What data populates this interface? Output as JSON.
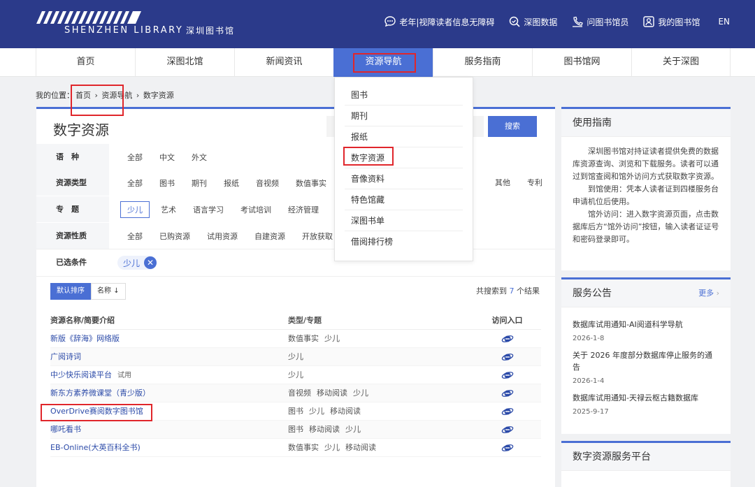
{
  "header": {
    "logo_en": "SHENZHEN LIBRARY",
    "logo_cn": "深圳图书馆",
    "links": [
      {
        "label": "老年|视障读者信息无障碍",
        "icon": "accessibility-chat-icon"
      },
      {
        "label": "深图数据",
        "icon": "search-data-icon"
      },
      {
        "label": "问图书馆员",
        "icon": "librarian-icon"
      },
      {
        "label": "我的图书馆",
        "icon": "user-card-icon"
      },
      {
        "label": "EN",
        "icon": ""
      }
    ]
  },
  "nav": {
    "items": [
      "首页",
      "深图北馆",
      "新闻资讯",
      "资源导航",
      "服务指南",
      "图书馆网",
      "关于深图"
    ],
    "active_index": 3
  },
  "breadcrumb": {
    "prefix": "我的位置：",
    "items": [
      "首页",
      "资源导航",
      "数字资源"
    ],
    "sep": "›"
  },
  "main": {
    "title": "数字资源",
    "search_button": "搜索",
    "filters": [
      {
        "label": "语　种",
        "options": [
          "全部",
          "中文",
          "外文"
        ]
      },
      {
        "label": "资源类型",
        "options": [
          "全部",
          "图书",
          "期刊",
          "报纸",
          "音视频",
          "数值事实"
        ],
        "options_right": [
          "其他",
          "专利"
        ]
      },
      {
        "label": "专　题",
        "options": [
          "少儿",
          "艺术",
          "语言学习",
          "考试培训",
          "经济管理"
        ],
        "selected": "少儿"
      },
      {
        "label": "资源性质",
        "options": [
          "全部",
          "已购资源",
          "试用资源",
          "自建资源",
          "开放获取"
        ]
      }
    ],
    "selected_label": "已选条件",
    "selected_tag": "少儿",
    "sort_default": "默认排序",
    "sort_name": "名称",
    "result_prefix": "共搜索到",
    "result_count": "7",
    "result_suffix": "个结果",
    "table": {
      "headers": [
        "资源名称/简要介绍",
        "类型/专题",
        "访问入口"
      ],
      "rows": [
        {
          "name": "新版《辞海》网络版",
          "trial": "",
          "tags": [
            "数值事实",
            "少儿"
          ]
        },
        {
          "name": "广阅诗词",
          "trial": "",
          "tags": [
            "少儿"
          ]
        },
        {
          "name": "中少快乐阅读平台",
          "trial": "试用",
          "tags": [
            "少儿"
          ]
        },
        {
          "name": "新东方素养微课堂（青少版）",
          "trial": "",
          "tags": [
            "音视频",
            "移动阅读",
            "少儿"
          ]
        },
        {
          "name": "OverDrive赛阅数字图书馆",
          "trial": "",
          "tags": [
            "图书",
            "少儿",
            "移动阅读"
          ]
        },
        {
          "name": "哪吒看书",
          "trial": "",
          "tags": [
            "图书",
            "移动阅读",
            "少儿"
          ]
        },
        {
          "name": "EB-Online(大英百科全书)",
          "trial": "",
          "tags": [
            "数值事实",
            "少儿",
            "移动阅读"
          ]
        }
      ]
    }
  },
  "dropdown": {
    "items": [
      "图书",
      "期刊",
      "报纸",
      "数字资源",
      "音像资料",
      "特色馆藏",
      "深图书单",
      "借阅排行榜"
    ],
    "highlight_index": 3
  },
  "sidebar": {
    "guide": {
      "title": "使用指南",
      "paragraphs": [
        "深圳图书馆对持证读者提供免费的数据库资源查询、浏览和下载服务。读者可以通过到馆查阅和馆外访问方式获取数字资源。",
        "到馆使用：凭本人读者证到四楼服务台申请机位后使用。",
        "馆外访问：进入数字资源页面，点击数据库后方“馆外访问”按钮，输入读者证证号和密码登录即可。"
      ]
    },
    "notice": {
      "title": "服务公告",
      "more": "更多",
      "items": [
        {
          "title": "数据库试用通知-AI阅道科学导航",
          "date": "2026-1-8"
        },
        {
          "title": "关于 2026 年度部分数据库停止服务的通告",
          "date": "2026-1-4"
        },
        {
          "title": "数据库试用通知-天禄云枢古籍数据库",
          "date": "2025-9-17"
        }
      ]
    },
    "platform": {
      "title": "数字资源服务平台"
    }
  },
  "colors": {
    "brand": "#2b3a8a",
    "accent": "#4a6fd4",
    "highlight": "#e0262b"
  }
}
